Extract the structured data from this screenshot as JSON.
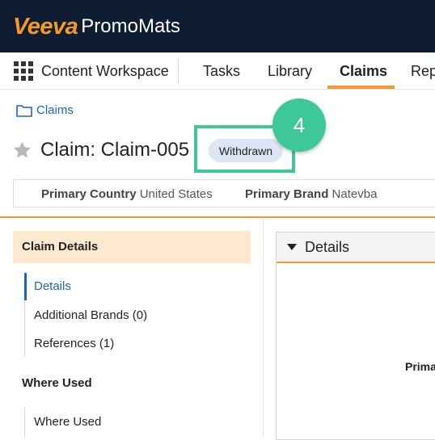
{
  "brand": {
    "company": "Veeva",
    "product": "PromoMats",
    "accent_color": "#f59a23",
    "header_bg": "#0e1c34"
  },
  "nav": {
    "workspace": "Content Workspace",
    "tabs": [
      {
        "label": "Tasks",
        "active": false
      },
      {
        "label": "Library",
        "active": false
      },
      {
        "label": "Claims",
        "active": true
      },
      {
        "label": "Rep",
        "active": false
      }
    ]
  },
  "breadcrumb": {
    "label": "Claims",
    "icon": "folder-icon"
  },
  "record": {
    "title": "Claim: Claim-005",
    "status": "Withdrawn",
    "favorite_icon": "star-icon"
  },
  "properties": [
    {
      "key": "Primary Country",
      "value": "United States"
    },
    {
      "key": "Primary Brand",
      "value": "Natevba"
    }
  ],
  "annotation": {
    "step": "4",
    "color": "#3ec89a"
  },
  "sidebar": {
    "section_title": "Claim Details",
    "items": [
      {
        "label": "Details",
        "active": true
      },
      {
        "label": "Additional Brands (0)",
        "active": false
      },
      {
        "label": "References (1)",
        "active": false
      }
    ],
    "where_used_title": "Where Used",
    "where_used_items": [
      {
        "label": "Where Used"
      }
    ]
  },
  "details_panel": {
    "title": "Details",
    "field_label_partial": "Prima"
  }
}
